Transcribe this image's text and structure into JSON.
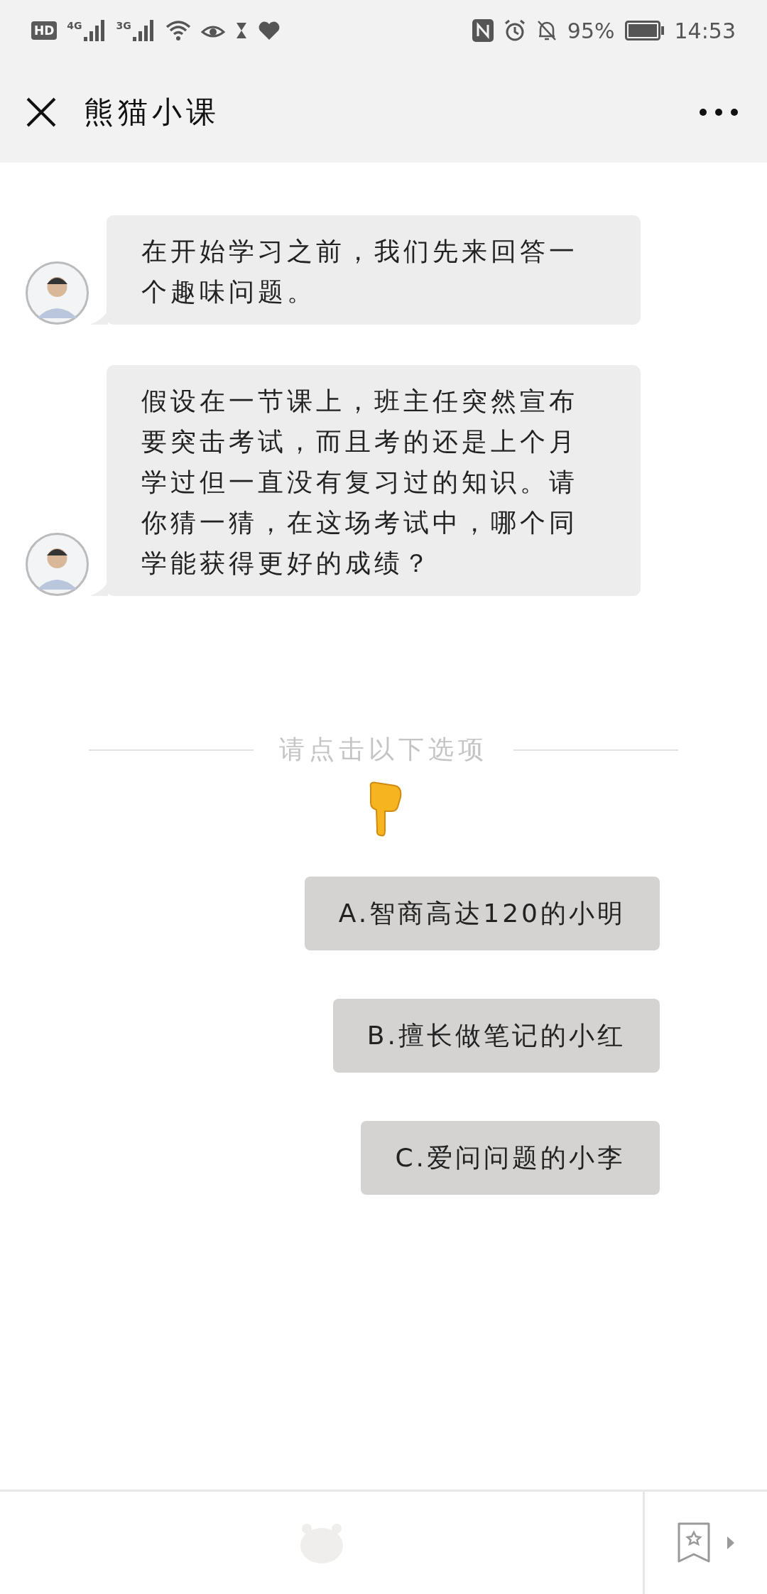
{
  "status_bar": {
    "network_badge": "HD",
    "sim_1": "4G",
    "sim_2": "3G",
    "battery": "95%",
    "time": "14:53"
  },
  "header": {
    "title": "熊猫小课"
  },
  "messages": [
    {
      "text": "在开始学习之前，我们先来回答一个趣味问题。"
    },
    {
      "text": "假设在一节课上，班主任突然宣布要突击考试，而且考的还是上个月学过但一直没有复习过的知识。请你猜一猜，在这场考试中，哪个同学能获得更好的成绩？"
    }
  ],
  "prompt": "请点击以下选项",
  "options": [
    {
      "label": "A.智商高达120的小明"
    },
    {
      "label": "B.擅长做笔记的小红"
    },
    {
      "label": "C.爱问问题的小李"
    }
  ]
}
